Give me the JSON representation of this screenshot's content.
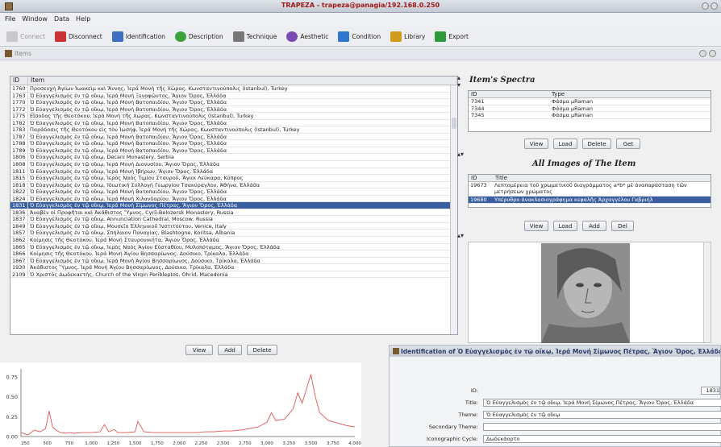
{
  "window": {
    "title": "TRAPEZA - trapeza@panagia/192.168.0.250"
  },
  "menu": [
    "File",
    "Window",
    "Data",
    "Help"
  ],
  "toolbar": [
    {
      "label": "Connect",
      "icon": "plug-icon",
      "disabled": true
    },
    {
      "label": "Disconnect",
      "icon": "disconnect-icon",
      "disabled": false
    },
    {
      "label": "Identification",
      "icon": "identification-icon",
      "disabled": false
    },
    {
      "label": "Description",
      "icon": "description-icon",
      "disabled": false
    },
    {
      "label": "Technique",
      "icon": "technique-icon",
      "disabled": false
    },
    {
      "label": "Aesthetic",
      "icon": "aesthetic-icon",
      "disabled": false
    },
    {
      "label": "Condition",
      "icon": "condition-icon",
      "disabled": false
    },
    {
      "label": "Library",
      "icon": "library-icon",
      "disabled": false
    },
    {
      "label": "Export",
      "icon": "export-icon",
      "disabled": false
    }
  ],
  "frame": {
    "title": "Items"
  },
  "items_table": {
    "headers": [
      "ID",
      "Item"
    ],
    "selected_id": "1831",
    "rows": [
      [
        "1760",
        "Προσευχή Άγίων Ἰωακεὶμ καὶ Ἄννης, Ἱερά Μονή τῆς Χώρας, Κωνσταντινούπολις (Istanbul), Turkey"
      ],
      [
        "1763",
        "Ὁ Εὐαγγελισμὸς ἐν τῷ οἴκῳ, Ἱερά Μονή Ξενοφῶντος, Ἅγιον Ὄρος, Ἑλλάδα"
      ],
      [
        "1770",
        "Ὁ Εὐαγγελισμὸς ἐν τῷ οἴκῳ, Ἱερά Μονή Βατοπαιδίου, Ἅγιον Ὄρος, Ἑλλάδα"
      ],
      [
        "1772",
        "Ὁ Εὐαγγελισμὸς ἐν τῷ οἴκῳ, Ἱερά Μονή Βατοπαιδίου, Ἅγιον Ὄρος, Ἑλλάδα"
      ],
      [
        "1775",
        "Εἴσοδος τῆς Θεοτόκου, Ἱερά Μονή τῆς Χώρας, Κωνσταντινούπολις (Istanbul), Turkey"
      ],
      [
        "1782",
        "Ὁ Εὐαγγελισμὸς ἐν τῷ οἴκῳ, Ἱερά Μονή Βατοπαιδίου, Ἅγιον Ὄρος, Ἑλλάδα"
      ],
      [
        "1783",
        "Παράδοσις τῆς Θεοτόκου εἰς τὸν Ἰωσήφ, Ἱερά Μονή τῆς Χώρας, Κωνσταντινούπολις (Istanbul), Turkey"
      ],
      [
        "1787",
        "Ὁ Εὐαγγελισμὸς ἐν τῷ οἴκῳ, Ἱερά Μονή Βατοπαιδίου, Ἅγιον Ὄρος, Ἑλλάδα"
      ],
      [
        "1788",
        "Ὁ Εὐαγγελισμὸς ἐν τῷ οἴκῳ, Ἱερά Μονή Βατοπαιδίου, Ἅγιον Ὄρος, Ἑλλάδα"
      ],
      [
        "1789",
        "Ὁ Εὐαγγελισμὸς ἐν τῷ οἴκῳ, Ἱερά Μονή Βατοπαιδίου, Ἅγιον Ὄρος, Ἑλλάδα"
      ],
      [
        "1806",
        "Ὁ Εὐαγγελισμὸς ἐν τῷ οἴκῳ, Decani Monastery, Serbia"
      ],
      [
        "1808",
        "Ὁ Εὐαγγελισμὸς ἐν τῷ οἴκῳ, Ἱερά Μονή Διονυσίου, Ἅγιον Ὄρος, Ἑλλάδα"
      ],
      [
        "1811",
        "Ὁ Εὐαγγελισμὸς ἐν τῷ οἴκῳ, Ἱερά Μονή Ἰβήρων, Ἅγιον Ὄρος, Ἑλλάδα"
      ],
      [
        "1815",
        "Ὁ Εὐαγγελισμὸς ἐν τῷ οἴκῳ, Ἱερὸς Ναὸς Τιμίου Σταυροῦ, Ἅγιοι Λεύκαρα, Κύπρος"
      ],
      [
        "1818",
        "Ὁ Εὐαγγελισμὸς ἐν τῷ οἴκῳ, Ἰδιωτική Συλλογή Γεωργίου Τσακύραγλου, Ἀθήνα, Ἑλλάδα"
      ],
      [
        "1822",
        "Ὁ Εὐαγγελισμὸς ἐν τῷ οἴκῳ, Ἱερά Μονή Βατοπαιδίου, Ἅγιον Ὄρος, Ἑλλάδα"
      ],
      [
        "1824",
        "Ὁ Εὐαγγελισμὸς ἐν τῷ οἴκῳ, Ἱερά Μονή Χιλανδαρίου, Ἅγιον Ὄρος, Ἑλλάδα"
      ],
      [
        "1831",
        "Ὁ Εὐαγγελισμὸς ἐν τῷ οἴκῳ, Ἱερά Μονή Σίμωνος Πέτρας, Ἅγιον Ὄρος, Ἑλλάδα"
      ],
      [
        "1836",
        "Ἀναβὲν οἱ Προφῆται καὶ Ἀκάθιστος Ὕμνος, Cyril-Belozersk Monastery, Russia"
      ],
      [
        "1837",
        "Ὁ Εὐαγγελισμὸς ἐν τῷ οἴκῳ, Annunciation Cathedral, Moscow, Russia"
      ],
      [
        "1849",
        "Ὁ Εὐαγγελισμὸς ἐν τῷ οἴκῳ, Μουσεῖο Ἑλληνικοῦ Ἰνστιτούτου, Venice, Italy"
      ],
      [
        "1857",
        "Ὁ Εὐαγγελισμὸς ἐν τῷ οἴκῳ, Σπήλαιον Παναγίας, Blashtogne, Koritsa, Albania"
      ],
      [
        "1862",
        "Κοίμησις τῆς Θεοτόκου, Ἱερά Μονή Σταυρονικήτα, Ἅγιον Ὄρος, Ἑλλάδα"
      ],
      [
        "1865",
        "Ὁ Εὐαγγελισμὸς ἐν τῷ οἴκῳ, Ἱερὸς Ναὸς Ἁγίου Εὐσταθίου, Μυλοπόταμος, Ἅγιον Ὄρος, Ἑλλάδα"
      ],
      [
        "1866",
        "Κοίμησις τῆς Θεοτόκου, Ἱερά Μονή Ἁγίου Βησσαρίωνος, Δούσικο, Τρίκαλα, Ἑλλάδα"
      ],
      [
        "1867",
        "Ὁ Εὐαγγελισμὸς ἐν τῷ οἴκῳ, Ἱερά Μονή Ἁγίου Βησσαρίωνος, Δούσικο, Τρίκαλα, Ἑλλάδα"
      ],
      [
        "1930",
        "Ἀκάθιστος Ὕμνος, Ἱερά Μονή Ἁγίου Βησσαρίωνος, Δούσικο, Τρίκαλα, Ἑλλάδα"
      ],
      [
        "2109",
        "Ὁ Χριστὸς Δωδεκαετής, Church of the Virgin Peribleptos, Ohrid, Macedonia"
      ]
    ]
  },
  "items_buttons": [
    "View",
    "Add",
    "Delete"
  ],
  "spectra": {
    "title": "Item's Spectra",
    "headers": [
      "ID",
      "Type"
    ],
    "rows": [
      [
        "7341",
        "Φάσμα μRaman"
      ],
      [
        "7344",
        "Φάσμα μRaman"
      ],
      [
        "7345",
        "Φάσμα μRaman"
      ]
    ],
    "buttons": [
      "View",
      "Load",
      "Delete",
      "Get"
    ]
  },
  "images": {
    "title": "All Images of The Item",
    "headers": [
      "ID",
      "Title"
    ],
    "rows": [
      [
        "19673",
        "Λεπτομέρεια τοῦ χρωματικοῦ διαγράμματος a*b* μὲ ἀναπαράσταση τῶν μετρήσεων χρώματος"
      ],
      [
        "19680",
        "Υπέρυθρο ἀνακλασιογράφημα κεφαλῆς Ἀρχαγγέλου Γαβριήλ"
      ]
    ],
    "buttons": [
      "View",
      "Load",
      "Add",
      "Del"
    ]
  },
  "identification": {
    "header": "Identification of Ὁ Εὐαγγελισμὸς ἐν τῷ οἴκῳ, Ἱερά Μονή Σίμωνος Πέτρας, Ἅγιον Ὄρος, Ἑλλάδα",
    "id_label": "ID:",
    "id_value": "1831",
    "title_label": "Title:",
    "title_value": "Ὁ Εὐαγγελισμὸς ἐν τῷ οἴκῳ, Ἱερά Μονή Σίμωνος Πέτρας, Ἅγιον Ὄρος, Ἑλλάδα",
    "theme_label": "Theme:",
    "theme_value": "Ὁ Εὐαγγελισμὸς ἐν τῷ οἴκῳ",
    "sectheme_label": "Secondary Theme:",
    "sectheme_value": "",
    "cycle_label": "Iconographic Cycle:",
    "cycle_value": "Δωδεκάορτο"
  },
  "chart_data": {
    "type": "line",
    "title": "",
    "xlabel": "",
    "ylabel": "",
    "color": "#e05555",
    "xlim": [
      200,
      4000
    ],
    "ylim": [
      0,
      0.85
    ],
    "yticks": [
      0.0,
      0.25,
      0.5,
      0.75
    ],
    "xticks": [
      250,
      500,
      750,
      1000,
      1250,
      1500,
      1750,
      2000,
      2250,
      2500,
      2750,
      3000,
      3250,
      3500,
      3750,
      4000
    ],
    "x": [
      200,
      280,
      350,
      420,
      480,
      520,
      560,
      600,
      650,
      700,
      750,
      800,
      900,
      1000,
      1100,
      1150,
      1200,
      1260,
      1300,
      1400,
      1500,
      1530,
      1600,
      1700,
      1800,
      1900,
      2000,
      2100,
      2200,
      2300,
      2400,
      2500,
      2600,
      2700,
      2800,
      2900,
      3000,
      3050,
      3100,
      3200,
      3300,
      3350,
      3400,
      3450,
      3500,
      3550,
      3600,
      3700,
      3800,
      3900,
      4000
    ],
    "y": [
      0.05,
      0.02,
      0.08,
      0.06,
      0.1,
      0.32,
      0.12,
      0.08,
      0.05,
      0.04,
      0.05,
      0.04,
      0.05,
      0.05,
      0.06,
      0.15,
      0.06,
      0.09,
      0.05,
      0.05,
      0.06,
      0.19,
      0.06,
      0.05,
      0.05,
      0.05,
      0.05,
      0.05,
      0.05,
      0.06,
      0.06,
      0.07,
      0.07,
      0.08,
      0.1,
      0.12,
      0.18,
      0.3,
      0.2,
      0.22,
      0.35,
      0.55,
      0.42,
      0.6,
      0.78,
      0.5,
      0.3,
      0.2,
      0.17,
      0.14,
      0.12
    ]
  }
}
